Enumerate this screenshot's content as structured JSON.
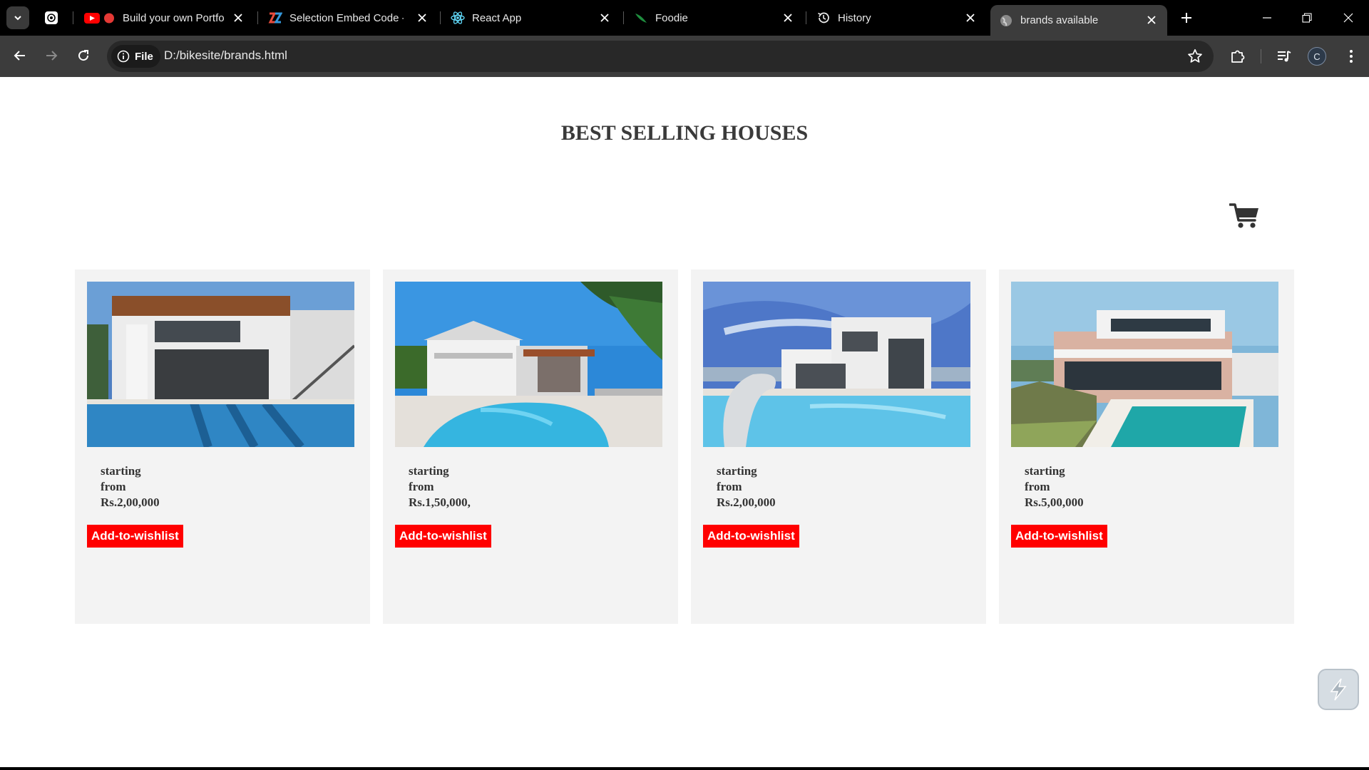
{
  "browser": {
    "tabs": [
      {
        "title": "Build your own Portfo",
        "favicon": "youtube-icon",
        "recording": true,
        "active": false
      },
      {
        "title": "Selection Embed Code - C",
        "favicon": "embed-code-icon",
        "active": false
      },
      {
        "title": "React App",
        "favicon": "react-icon",
        "active": false
      },
      {
        "title": "Foodie",
        "favicon": "foodie-leaf-icon",
        "active": false
      },
      {
        "title": "History",
        "favicon": "history-icon",
        "active": false
      },
      {
        "title": "brands available",
        "favicon": "globe-icon",
        "active": true
      }
    ],
    "address": {
      "chip_label": "File",
      "url": "D:/bikesite/brands.html"
    },
    "profile_initial": "C"
  },
  "page": {
    "title": "BEST SELLING HOUSES",
    "cart_icon": "shopping-cart-icon",
    "cards": [
      {
        "price_line1": "starting",
        "price_line2": "from",
        "price_line3": "Rs.2,00,000",
        "button": "Add-to-wishlist",
        "image": "modern-villa-pool"
      },
      {
        "price_line1": "starting",
        "price_line2": "from",
        "price_line3": "Rs.1,50,000,",
        "button": "Add-to-wishlist",
        "image": "colonial-house-pool"
      },
      {
        "price_line1": "starting",
        "price_line2": "from",
        "price_line3": "Rs.2,00,000",
        "button": "Add-to-wishlist",
        "image": "white-villa-pool"
      },
      {
        "price_line1": "starting",
        "price_line2": "from",
        "price_line3": "Rs.5,00,000",
        "button": "Add-to-wishlist",
        "image": "pink-villa-pool"
      }
    ]
  },
  "colors": {
    "wishlist_button": "#ff0000",
    "card_background": "#f3f3f3",
    "title_text": "#3a3a3a"
  }
}
